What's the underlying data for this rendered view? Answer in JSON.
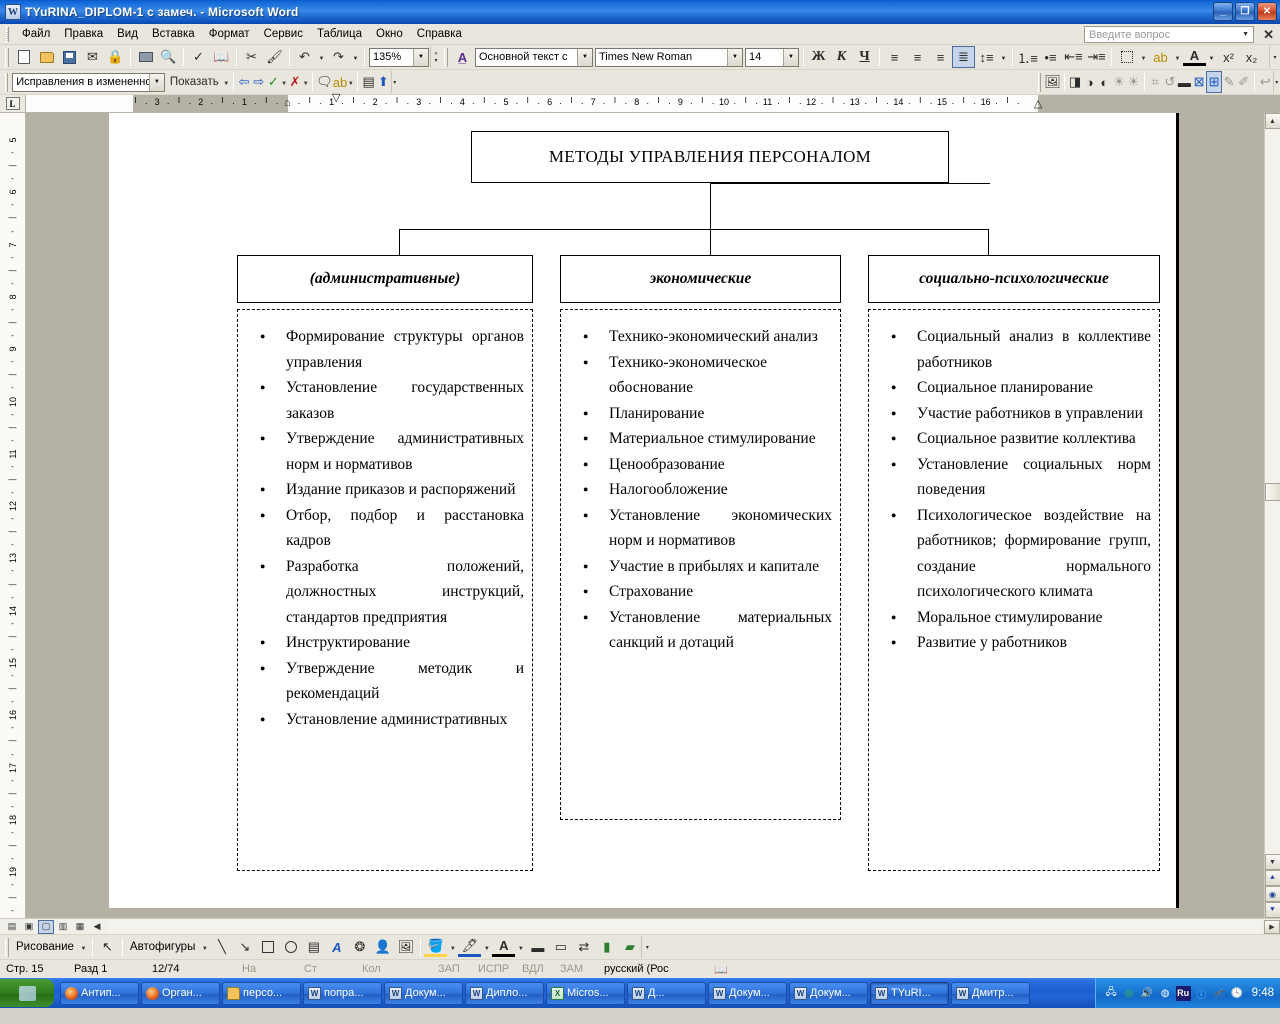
{
  "window": {
    "title": "TYuRINA_DIPLOM-1 с замеч. - Microsoft Word",
    "app_icon": "word-icon",
    "minimize": "_",
    "restore": "❐",
    "close": "✕"
  },
  "menu": {
    "items": [
      "Файл",
      "Правка",
      "Вид",
      "Вставка",
      "Формат",
      "Сервис",
      "Таблица",
      "Окно",
      "Справка"
    ],
    "ask_placeholder": "Введите вопрос"
  },
  "toolbar_standard": {
    "zoom_value": "135%",
    "style_value": "Основной текст с",
    "font_value": "Times New Roman",
    "size_value": "14",
    "bold": "Ж",
    "italic": "К",
    "underline": "Ч",
    "superscript": "x²",
    "subscript": "x₂"
  },
  "toolbar_review": {
    "display_value": "Исправления в измененном документе",
    "show_label": "Показать"
  },
  "drawing_toolbar": {
    "draw_label": "Рисование",
    "autoshapes_label": "Автофигуры"
  },
  "ruler": {
    "horizontal_numbers": [
      "3",
      "2",
      "1",
      "1",
      "2",
      "3",
      "4",
      "5",
      "6",
      "7",
      "8",
      "9",
      "10",
      "11",
      "12",
      "13",
      "14",
      "15",
      "16"
    ],
    "vertical_numbers": [
      "5",
      "6",
      "7",
      "8",
      "9",
      "10",
      "11",
      "12",
      "13",
      "14",
      "15",
      "16",
      "17",
      "18",
      "19"
    ]
  },
  "document": {
    "root_box": "МЕТОДЫ УПРАВЛЕНИЯ ПЕРСОНАЛОМ",
    "columns": [
      {
        "header": "(административные)",
        "items": [
          "Формирование структуры органов управления",
          "Установление государственных заказов",
          "Утверждение административных норм и нормативов",
          "Издание приказов и распоряжений",
          "Отбор, подбор и расстановка кадров",
          "Разработка положений, должностных инструкций, стандартов предприятия",
          "Инструктирование",
          "Утверждение методик и рекомендаций",
          "Установление административных"
        ]
      },
      {
        "header": "экономические",
        "items": [
          "Технико-экономический анализ",
          "Технико-экономическое обоснование",
          "Планирование",
          "Материальное стимулирование",
          "Ценообразование",
          "Налогообложение",
          "Установление экономических норм и нормативов",
          "Участие в прибылях и капитале",
          "Страхование",
          "Установление материальных санкций и дотаций"
        ]
      },
      {
        "header": "социально-психологические",
        "items": [
          "Социальный анализ в коллективе работников",
          "Социальное планирование",
          "Участие работников в управлении",
          "Социальное развитие коллектива",
          "Установление социальных норм поведения",
          "Психологическое воздействие на работников; формирование групп, создание нормального психологического климата",
          "Моральное стимулирование",
          "Развитие у работников"
        ]
      }
    ]
  },
  "statusbar": {
    "page": "Стр. 15",
    "section": "Разд 1",
    "page_of": "12/74",
    "at": "На",
    "line": "Ст",
    "col": "Кол",
    "rec": "ЗАП",
    "trk": "ИСПР",
    "ext": "ВДЛ",
    "ovr": "ЗАМ",
    "language": "русский (Рос"
  },
  "taskbar": {
    "start": "start",
    "items": [
      {
        "label": "Антип...",
        "icon": "firefox-icon",
        "active": false
      },
      {
        "label": "Орган...",
        "icon": "firefox-icon",
        "active": false
      },
      {
        "label": "персо...",
        "icon": "folder-icon",
        "active": false
      },
      {
        "label": "попра...",
        "icon": "word-icon",
        "active": false
      },
      {
        "label": "Докум...",
        "icon": "word-icon",
        "active": false
      },
      {
        "label": "Дипло...",
        "icon": "word-icon",
        "active": false
      },
      {
        "label": "Micros...",
        "icon": "excel-icon",
        "active": false
      },
      {
        "label": "Д...",
        "icon": "word-icon",
        "active": false
      },
      {
        "label": "Докум...",
        "icon": "word-icon",
        "active": false
      },
      {
        "label": "Докум...",
        "icon": "word-icon",
        "active": false
      },
      {
        "label": "TYuRI...",
        "icon": "word-icon",
        "active": true
      },
      {
        "label": "Дмитр...",
        "icon": "word-icon",
        "active": false
      }
    ],
    "tray": {
      "language": "Ru",
      "clock": "9:48"
    }
  },
  "colors": {
    "titlebar_blue": "#1368d8",
    "toolbar_bg": "#e9e7dd",
    "page_bg": "#ffffff",
    "desk_bg": "#b5b1a5",
    "taskbar_blue": "#1c5fd0"
  }
}
